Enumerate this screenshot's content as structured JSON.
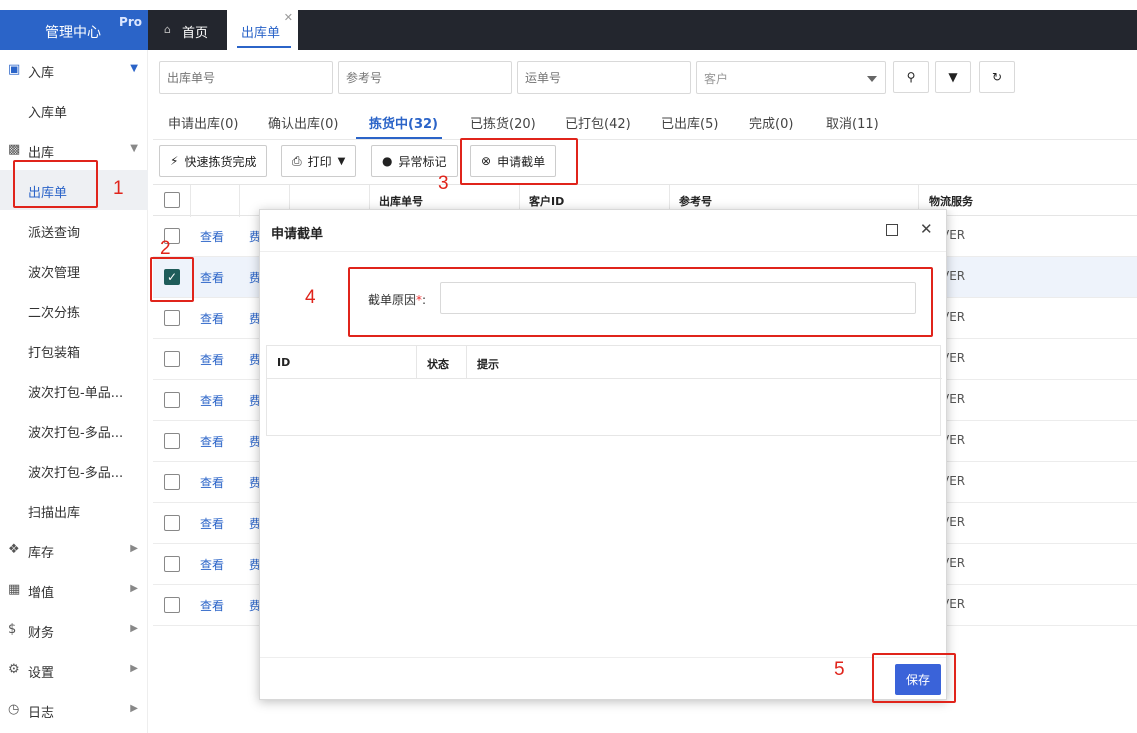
{
  "header": {
    "brand_title": "管理中心",
    "brand_badge": "Pro",
    "tabs": [
      {
        "label": "首页",
        "icon": "home-icon"
      },
      {
        "label": "出库单",
        "icon": "close-icon"
      }
    ]
  },
  "sidebar": {
    "items": [
      {
        "label": "入库",
        "icon": "inbox-icon",
        "expanded": true
      },
      {
        "label": "入库单"
      },
      {
        "label": "出库",
        "icon": "truck-icon",
        "expanded": true
      },
      {
        "label": "出库单",
        "selected": true
      },
      {
        "label": "派送查询"
      },
      {
        "label": "波次管理"
      },
      {
        "label": "二次分拣"
      },
      {
        "label": "打包装箱"
      },
      {
        "label": "波次打包-单品..."
      },
      {
        "label": "波次打包-多品..."
      },
      {
        "label": "波次打包-多品..."
      },
      {
        "label": "扫描出库"
      },
      {
        "label": "库存",
        "icon": "cubes-icon"
      },
      {
        "label": "增值",
        "icon": "grid-icon"
      },
      {
        "label": "财务",
        "icon": "dollar-icon"
      },
      {
        "label": "设置",
        "icon": "gears-icon"
      },
      {
        "label": "日志",
        "icon": "clock-icon"
      }
    ]
  },
  "search": {
    "order_no_placeholder": "出库单号",
    "ref_no_placeholder": "参考号",
    "tracking_no_placeholder": "运单号",
    "customer_placeholder": "客户"
  },
  "status_tabs": [
    "申请出库(0)",
    "确认出库(0)",
    "拣货中(32)",
    "已拣货(20)",
    "已打包(42)",
    "已出库(5)",
    "完成(0)",
    "取消(11)"
  ],
  "toolbar": {
    "quick_pick_label": "快速拣货完成",
    "print_label": "打印",
    "exception_label": "异常标记",
    "intercept_label": "申请截单"
  },
  "grid": {
    "columns": [
      "出库单号",
      "客户ID",
      "参考号",
      "物流服务"
    ],
    "view_label": "查看",
    "fee_label_partial": "费",
    "rows": [
      {
        "service": "VER",
        "checked": false
      },
      {
        "service": "VER",
        "checked": true
      },
      {
        "service": "VER",
        "checked": false
      },
      {
        "service": "VER",
        "checked": false
      },
      {
        "service": "VER",
        "checked": false
      },
      {
        "service": "VER",
        "checked": false
      },
      {
        "service": "VER",
        "checked": false
      },
      {
        "service": "VER",
        "checked": false
      },
      {
        "service": "VER",
        "checked": false
      },
      {
        "service": "VER",
        "checked": false
      }
    ]
  },
  "modal": {
    "title": "申请截单",
    "reason_label": "截单原因",
    "required_mark": "*",
    "colon": ":",
    "reason_value": "",
    "table_columns": [
      "ID",
      "状态",
      "提示"
    ],
    "save_label": "保存"
  },
  "annotations": [
    "1",
    "2",
    "3",
    "4",
    "5"
  ],
  "colors": {
    "accent": "#2b64c8",
    "topbar": "#23262e",
    "annotation": "#e0241b",
    "save_button": "#3a63d9",
    "checkbox_checked": "#1f5c5a"
  }
}
